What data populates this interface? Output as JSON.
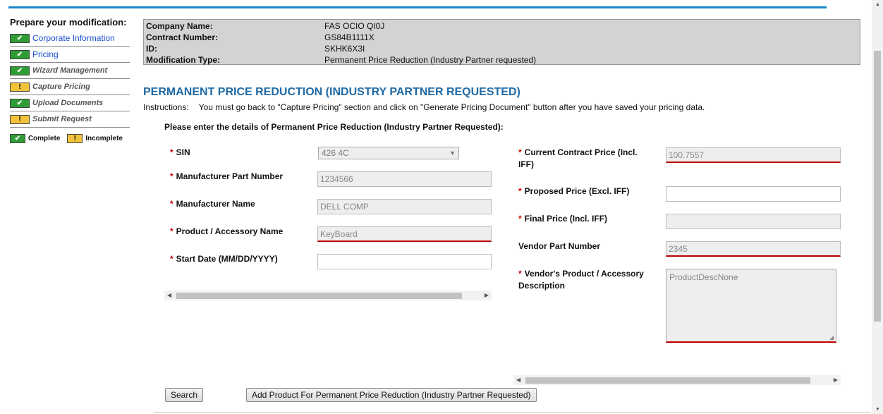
{
  "sidebar": {
    "title": "Prepare your modification:",
    "items": [
      {
        "label": "Corporate Information",
        "status": "complete"
      },
      {
        "label": "Pricing",
        "status": "complete"
      },
      {
        "label": "Wizard Management",
        "status": "complete"
      },
      {
        "label": "Capture Pricing",
        "status": "incomplete"
      },
      {
        "label": "Upload Documents",
        "status": "complete"
      },
      {
        "label": "Submit Request",
        "status": "incomplete"
      }
    ],
    "legend": {
      "complete": "Complete",
      "incomplete": "Incomplete"
    },
    "icons": {
      "complete": "✔",
      "incomplete": "!"
    }
  },
  "info": {
    "company_label": "Company Name:",
    "company_value": "FAS OCIO QI0J",
    "contract_label": "Contract Number:",
    "contract_value": "GS84B1111X",
    "id_label": "ID:",
    "id_value": "SKHK6X3I",
    "modtype_label": "Modification Type:",
    "modtype_value": "Permanent Price Reduction (Industry Partner requested)"
  },
  "page": {
    "heading": "PERMANENT PRICE REDUCTION (INDUSTRY PARTNER REQUESTED)",
    "instructions_lead": "Instructions:",
    "instructions_text": "You must go back to \"Capture Pricing\" section and click on \"Generate Pricing Document\" button after you have saved your pricing data.",
    "subheading": "Please enter the details of Permanent Price Reduction (Industry Partner Requested):"
  },
  "form": {
    "required_marker": "*",
    "sin_label": "SIN",
    "sin_value": "426 4C",
    "mpn_label": "Manufacturer Part Number",
    "mpn_value": "1234566",
    "mname_label": "Manufacturer Name",
    "mname_value": "DELL COMP",
    "product_label": "Product / Accessory Name",
    "product_value": "KeyBoard",
    "start_label": "Start Date (MM/DD/YYYY)",
    "start_value": "",
    "ccp_label_1": "Current Contract Price (Incl.",
    "ccp_label_2": "IFF)",
    "ccp_value": "100.7557",
    "proposed_label": "Proposed Price (Excl. IFF)",
    "proposed_value": "",
    "final_label": "Final Price (Incl. IFF)",
    "final_value": "",
    "vpn_label": "Vendor Part Number",
    "vpn_value": "2345",
    "vdesc_label_1": "Vendor's Product / Accessory",
    "vdesc_label_2": "Description",
    "vdesc_value": "ProductDescNone"
  },
  "buttons": {
    "search": "Search",
    "add": "Add Product For Permanent Price Reduction (Industry Partner Requested)"
  },
  "colors": {
    "accent": "#1a88c9",
    "heading": "#1f6aa5",
    "complete": "#2e9d34",
    "incomplete": "#f2c23a",
    "error": "#b00000"
  }
}
